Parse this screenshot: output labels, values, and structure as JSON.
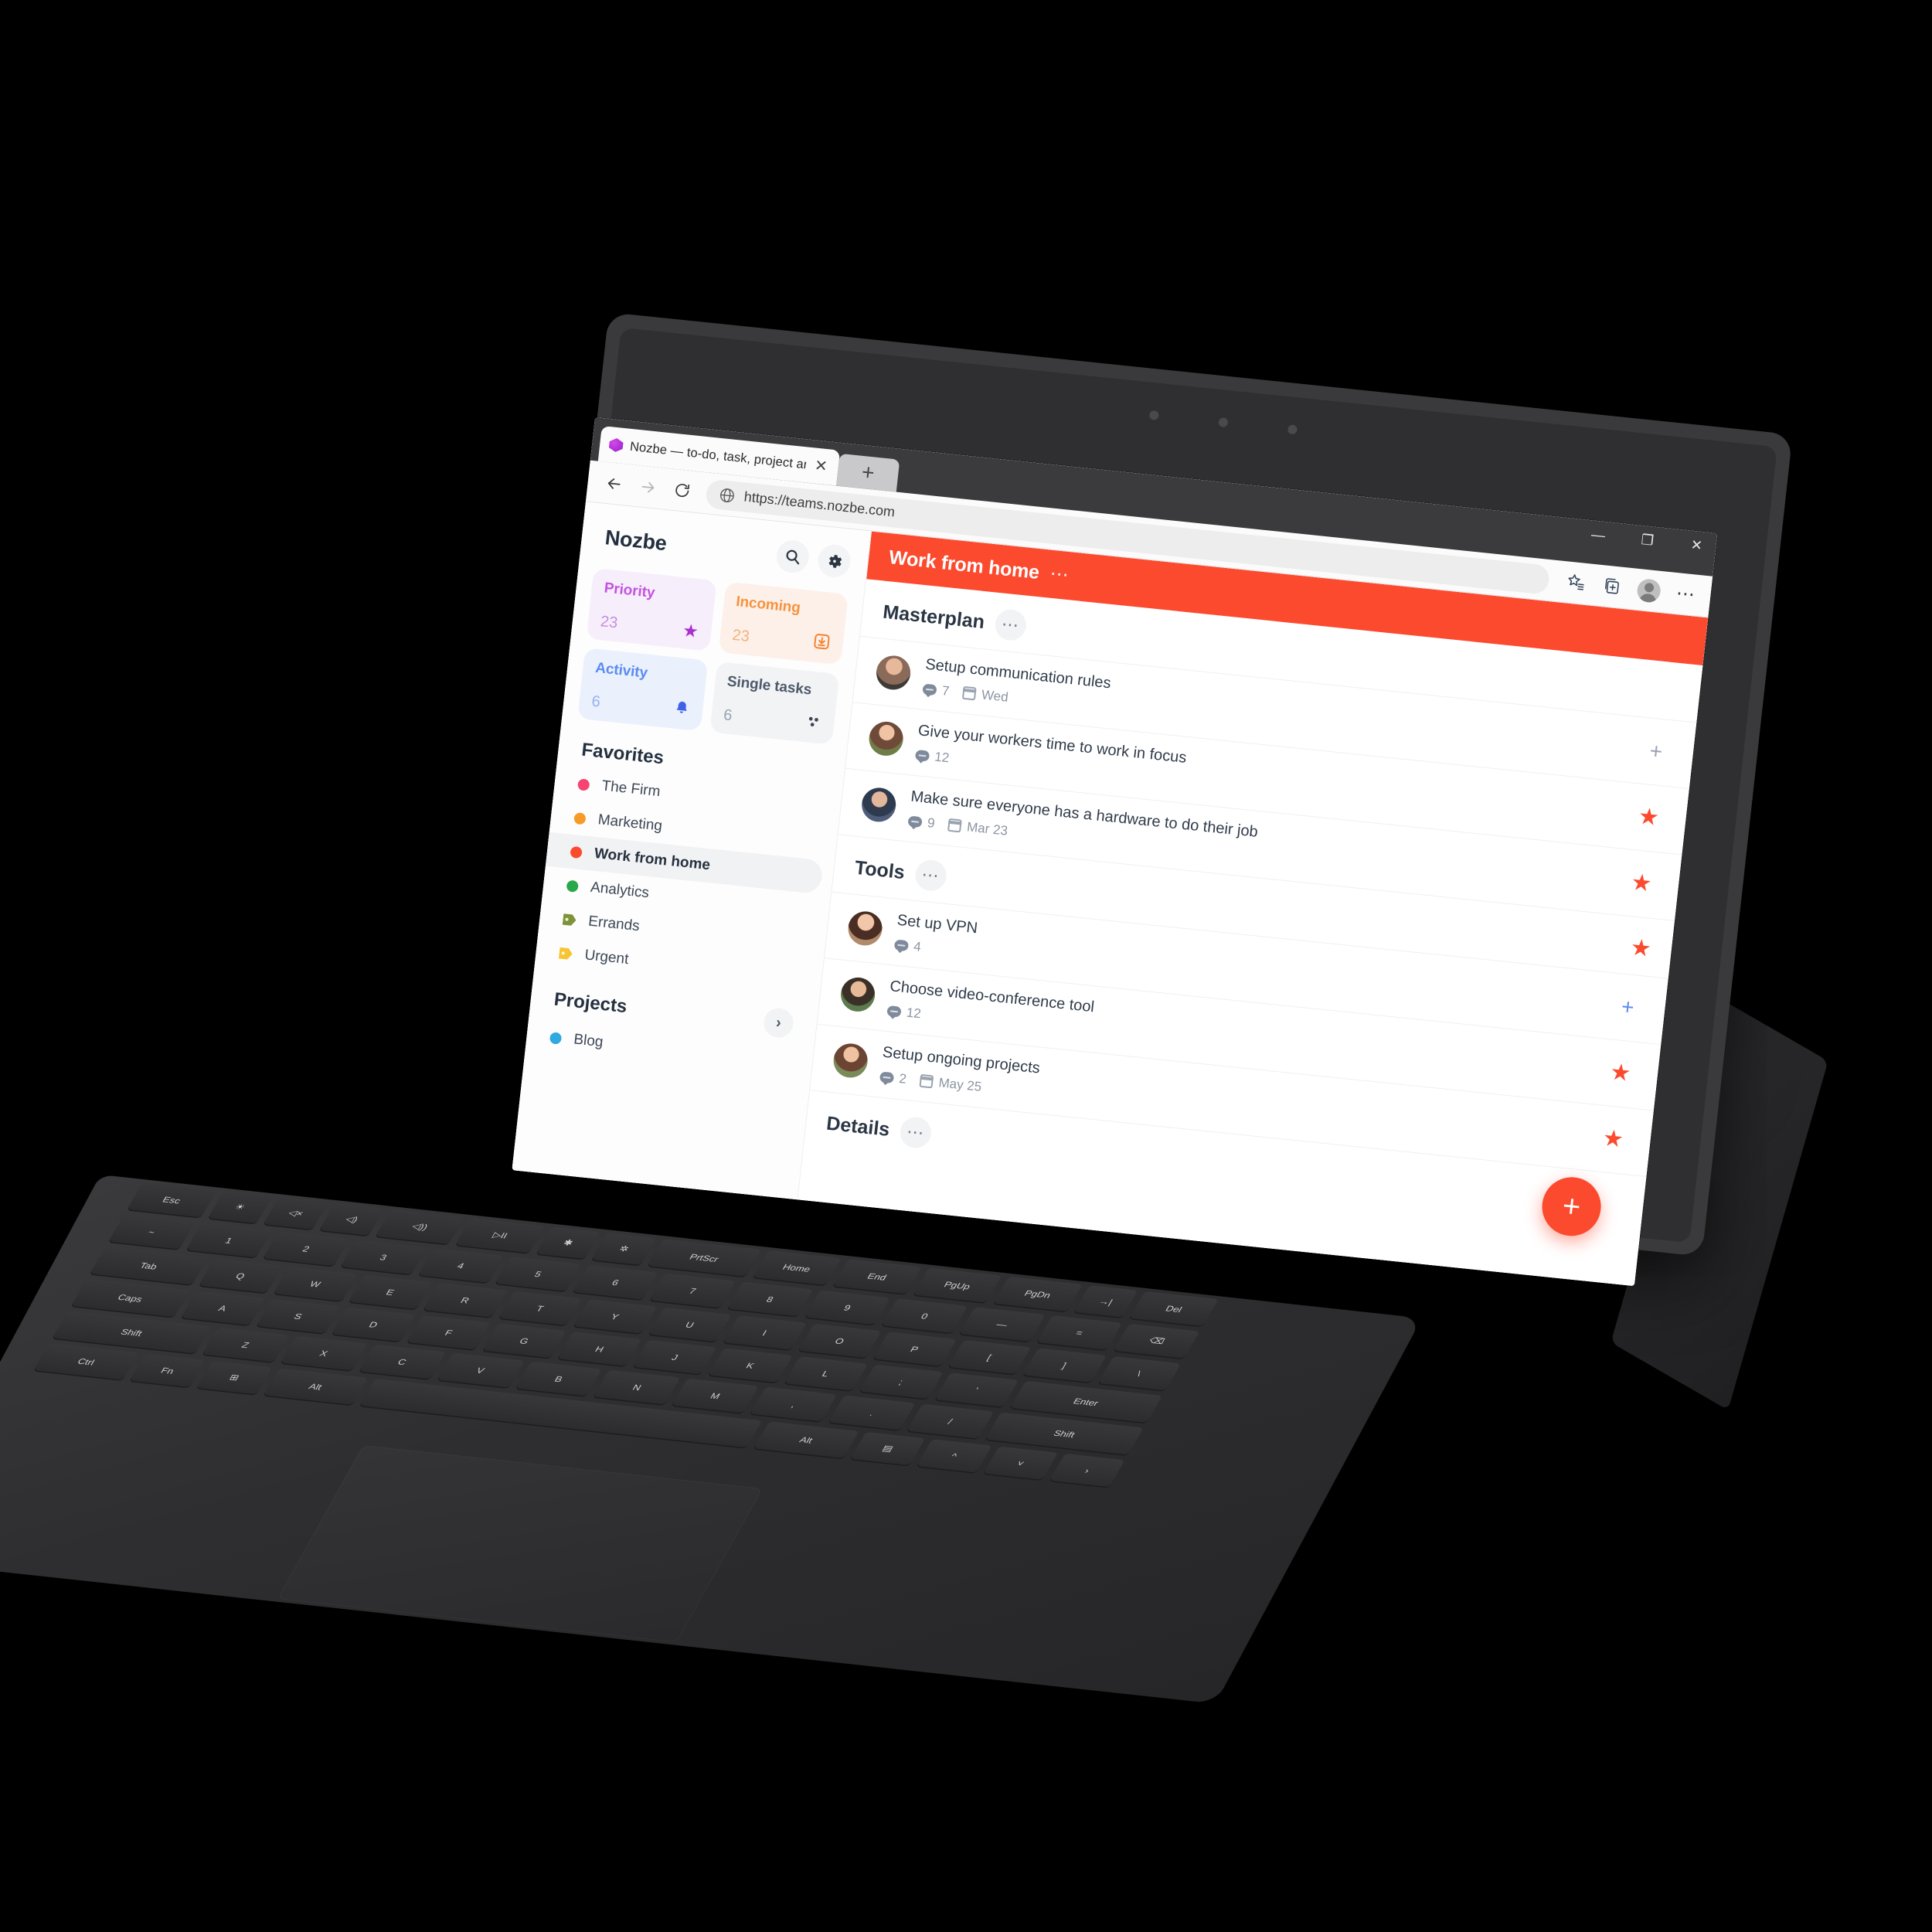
{
  "browser": {
    "tab": {
      "title": "Nozbe — to-do, task, project anc",
      "favicon": "nozbe-logo-icon",
      "close": "✕"
    },
    "new_tab_label": "+",
    "window_controls": {
      "minimize": "—",
      "maximize": "❐",
      "close": "✕"
    },
    "nav": {
      "back": "←",
      "forward": "→",
      "reload": "↻"
    },
    "omnibox": {
      "icon": "globe-icon",
      "url": "https://teams.nozbe.com"
    },
    "toolbar_right": {
      "favorites": "☆",
      "collections": "▣",
      "profile": "avatar",
      "more": "⋯"
    }
  },
  "sidebar": {
    "brand": "Nozbe",
    "search_icon": "🔍",
    "settings_icon": "⚙",
    "cards": [
      {
        "title": "Priority",
        "count": "23",
        "icon": "★",
        "bg": "#f7eefb",
        "fg": "#c453e0",
        "icon_color": "#a82fd0"
      },
      {
        "title": "Incoming",
        "count": "23",
        "icon": "⤓",
        "bg": "#fdf0e9",
        "fg": "#f5933f",
        "icon_color": "#f4812b"
      },
      {
        "title": "Activity",
        "count": "6",
        "icon": "🔔",
        "bg": "#eaf0fc",
        "fg": "#5b8cf0",
        "icon_color": "#3f63e8"
      },
      {
        "title": "Single tasks",
        "count": "6",
        "icon": "⣿",
        "bg": "#f2f3f5",
        "fg": "#4d5a6b",
        "icon_color": "#3d4655"
      }
    ],
    "favorites_heading": "Favorites",
    "favorites": [
      {
        "label": "The Firm",
        "color": "#f7436f",
        "type": "dot",
        "active": false
      },
      {
        "label": "Marketing",
        "color": "#f79a28",
        "type": "dot",
        "active": false
      },
      {
        "label": "Work from home",
        "color": "#fc4a2e",
        "type": "dot",
        "active": true
      },
      {
        "label": "Analytics",
        "color": "#27a84a",
        "type": "dot",
        "active": false
      },
      {
        "label": "Errands",
        "color": "#7e9338",
        "type": "tag",
        "active": false
      },
      {
        "label": "Urgent",
        "color": "#f7c433",
        "type": "tag",
        "active": false
      }
    ],
    "projects_heading": "Projects",
    "projects_chevron": "›",
    "projects": [
      {
        "label": "Blog",
        "color": "#31a8e0",
        "type": "dot",
        "active": false
      }
    ]
  },
  "main": {
    "header": {
      "title": "Work from home",
      "dots": "⋯",
      "bg": "#fc4a2e"
    },
    "groups": [
      {
        "name": "Masterplan",
        "dots": "⋯",
        "tasks": [
          {
            "name": "Setup communication rules",
            "comments": "7",
            "date": "Wed",
            "action": "plus",
            "avatar": "#8a6a58"
          },
          {
            "name": "Give your workers time to work in focus",
            "comments": "12",
            "date": "",
            "action": "star",
            "avatar": "#6f7d49"
          },
          {
            "name": "Make sure everyone has a hardware to do their job",
            "comments": "9",
            "date": "Mar 23",
            "action": "star",
            "avatar": "#4e5e7a"
          }
        ]
      },
      {
        "name": "Tools",
        "dots": "⋯",
        "tasks": [
          {
            "name": "Set up VPN",
            "comments": "4",
            "date": "",
            "action": "plus",
            "avatar": "#a06a55"
          },
          {
            "name": "Choose video-conference tool",
            "comments": "12",
            "date": "",
            "action": "star",
            "avatar": "#5b7a4e"
          },
          {
            "name": "Setup ongoing projects",
            "comments": "2",
            "date": "May 25",
            "action": "star",
            "avatar": "#7a5a4a"
          }
        ]
      },
      {
        "name": "Details",
        "dots": "⋯",
        "tasks": []
      }
    ],
    "fab": {
      "label": "+",
      "color": "#fc4a2e"
    }
  },
  "keyboard": {
    "row_fn": [
      "Esc",
      "☀",
      "◁×",
      "◁)",
      "◁))",
      "▷II",
      "✱",
      "✲",
      "PrtScr",
      "Home",
      "End",
      "PgUp",
      "PgDn",
      "→|",
      "Del"
    ],
    "row_num": [
      "~",
      "1",
      "2",
      "3",
      "4",
      "5",
      "6",
      "7",
      "8",
      "9",
      "0",
      "—",
      "=",
      "⌫"
    ],
    "row_q": [
      "Tab",
      "Q",
      "W",
      "E",
      "R",
      "T",
      "Y",
      "U",
      "I",
      "O",
      "P",
      "[",
      "]",
      "\\"
    ],
    "row_a": [
      "Caps",
      "A",
      "S",
      "D",
      "F",
      "G",
      "H",
      "J",
      "K",
      "L",
      ";",
      "'",
      "Enter"
    ],
    "row_z": [
      "Shift",
      "Z",
      "X",
      "C",
      "V",
      "B",
      "N",
      "M",
      ",",
      ".",
      "/",
      "Shift"
    ],
    "row_ctl": [
      "Ctrl",
      "Fn",
      "⊞",
      "Alt",
      "",
      "Alt",
      "▤",
      "^",
      "˅",
      "›"
    ]
  }
}
